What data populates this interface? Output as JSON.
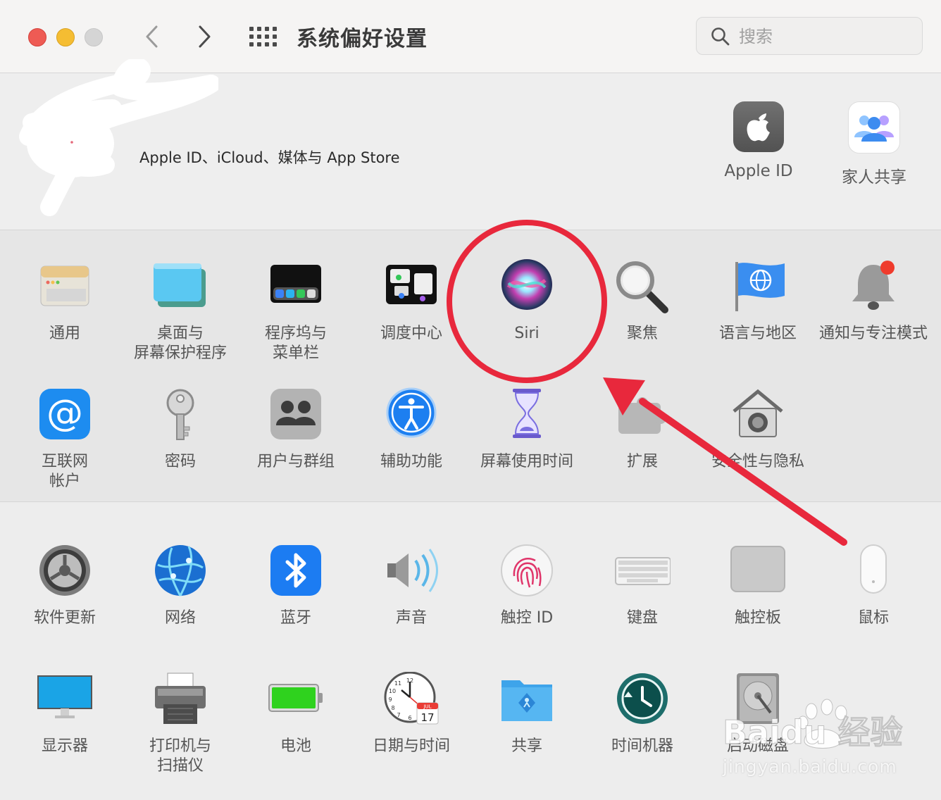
{
  "window": {
    "title": "系统偏好设置"
  },
  "search": {
    "placeholder": "搜索"
  },
  "account": {
    "description": "Apple ID、iCloud、媒体与 App Store",
    "items": [
      {
        "label": "Apple ID",
        "icon": "apple-logo-icon"
      },
      {
        "label": "家人共享",
        "icon": "family-sharing-icon"
      }
    ]
  },
  "panes_row1": [
    {
      "label": "通用",
      "icon": "general-icon"
    },
    {
      "label": "桌面与\n屏幕保护程序",
      "icon": "desktop-screensaver-icon"
    },
    {
      "label": "程序坞与\n菜单栏",
      "icon": "dock-menubar-icon"
    },
    {
      "label": "调度中心",
      "icon": "mission-control-icon"
    },
    {
      "label": "Siri",
      "icon": "siri-icon"
    },
    {
      "label": "聚焦",
      "icon": "spotlight-icon"
    },
    {
      "label": "语言与地区",
      "icon": "language-region-icon"
    },
    {
      "label": "通知与专注模式",
      "icon": "notifications-icon"
    }
  ],
  "panes_row2": [
    {
      "label": "互联网\n帐户",
      "icon": "internet-accounts-icon"
    },
    {
      "label": "密码",
      "icon": "passwords-icon"
    },
    {
      "label": "用户与群组",
      "icon": "users-groups-icon"
    },
    {
      "label": "辅助功能",
      "icon": "accessibility-icon"
    },
    {
      "label": "屏幕使用时间",
      "icon": "screen-time-icon"
    },
    {
      "label": "扩展",
      "icon": "extensions-icon"
    },
    {
      "label": "安全性与隐私",
      "icon": "security-privacy-icon"
    }
  ],
  "panes_row3": [
    {
      "label": "软件更新",
      "icon": "software-update-icon"
    },
    {
      "label": "网络",
      "icon": "network-icon"
    },
    {
      "label": "蓝牙",
      "icon": "bluetooth-icon"
    },
    {
      "label": "声音",
      "icon": "sound-icon"
    },
    {
      "label": "触控 ID",
      "icon": "touch-id-icon"
    },
    {
      "label": "键盘",
      "icon": "keyboard-icon"
    },
    {
      "label": "触控板",
      "icon": "trackpad-icon"
    },
    {
      "label": "鼠标",
      "icon": "mouse-icon"
    }
  ],
  "panes_row4": [
    {
      "label": "显示器",
      "icon": "displays-icon"
    },
    {
      "label": "打印机与\n扫描仪",
      "icon": "printers-scanners-icon"
    },
    {
      "label": "电池",
      "icon": "battery-icon"
    },
    {
      "label": "日期与时间",
      "icon": "date-time-icon"
    },
    {
      "label": "共享",
      "icon": "sharing-icon"
    },
    {
      "label": "时间机器",
      "icon": "time-machine-icon"
    },
    {
      "label": "启动磁盘",
      "icon": "startup-disk-icon"
    }
  ],
  "calendar_icon": {
    "month": "JUL",
    "day": "17"
  },
  "clock_icon": {
    "numerals": [
      "12",
      "11",
      "10",
      "9",
      "8",
      "7",
      "6"
    ]
  },
  "watermark": {
    "brand": "Baidu 经验",
    "url": "jingyan.baidu.com"
  },
  "colors": {
    "close": "#ee5b54",
    "minimize": "#f5bd32",
    "annotation_red": "#e8283c"
  }
}
